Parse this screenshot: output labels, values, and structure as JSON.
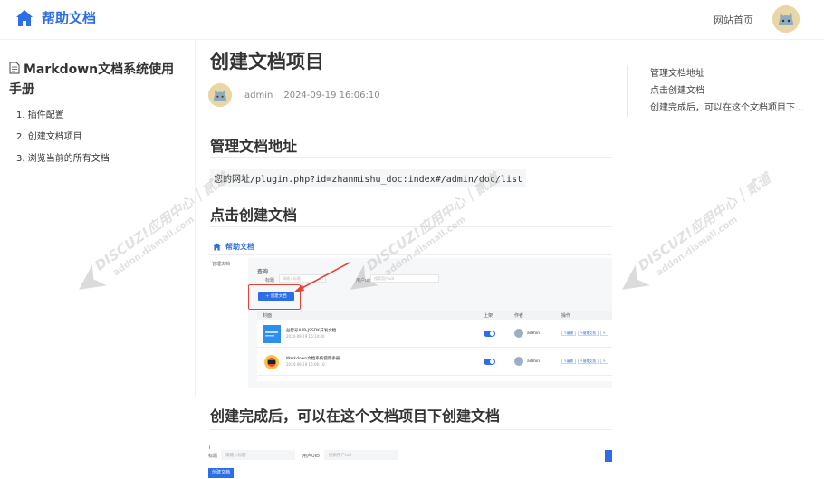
{
  "header": {
    "brand": "帮助文档",
    "nav_home": "网站首页"
  },
  "sidebar": {
    "title": "Markdown文档系统使用手册",
    "items": [
      {
        "label": "1. 插件配置"
      },
      {
        "label": "2. 创建文档项目"
      },
      {
        "label": "3. 浏览当前的所有文档"
      }
    ]
  },
  "main": {
    "title": "创建文档项目",
    "author": "admin",
    "date": "2024-09-19 16:06:10",
    "sections": [
      {
        "heading": "管理文档地址"
      },
      {
        "heading": "点击创建文档"
      },
      {
        "heading": "创建完成后，可以在这个文档项目下创建文档"
      }
    ],
    "code": "您的网址/plugin.php?id=zhanmishu_doc:index#/admin/doc/list"
  },
  "shot1": {
    "brand": "帮助文档",
    "side": "管理文档",
    "query": "查询",
    "title_label": "标题",
    "title_placeholder": "请输入标题",
    "uid_label": "用户uid",
    "uid_placeholder": "搜索用户uid",
    "create_button": "+ 创建文档",
    "columns": [
      "封面",
      "上架",
      "作者",
      "操作"
    ],
    "rows": [
      {
        "title": "益智号APP-JSSDK开发文档",
        "date": "2024-09-19 16:14:40",
        "author": "admin"
      },
      {
        "title": "Markdown文档系统使用手册",
        "date": "2024-09-19 16:06:10",
        "author": "admin"
      }
    ],
    "ops": [
      "✎编辑",
      "✎管理文档",
      "✎"
    ]
  },
  "shot2": {
    "title_label": "标题",
    "title_placeholder": "请输入标题",
    "uid_label": "用户UID",
    "uid_placeholder": "搜索用户uid",
    "create_button": "创建文档"
  },
  "toc": {
    "items": [
      {
        "label": "管理文档地址"
      },
      {
        "label": "点击创建文档"
      },
      {
        "label": "创建完成后，可以在这个文档项目下..."
      }
    ]
  },
  "watermark": {
    "text": "DISCUZ!应用中心｜贰道",
    "url": "addon.dismall.com"
  },
  "colors": {
    "accent": "#2d6ee8",
    "highlight": "#e64236"
  }
}
